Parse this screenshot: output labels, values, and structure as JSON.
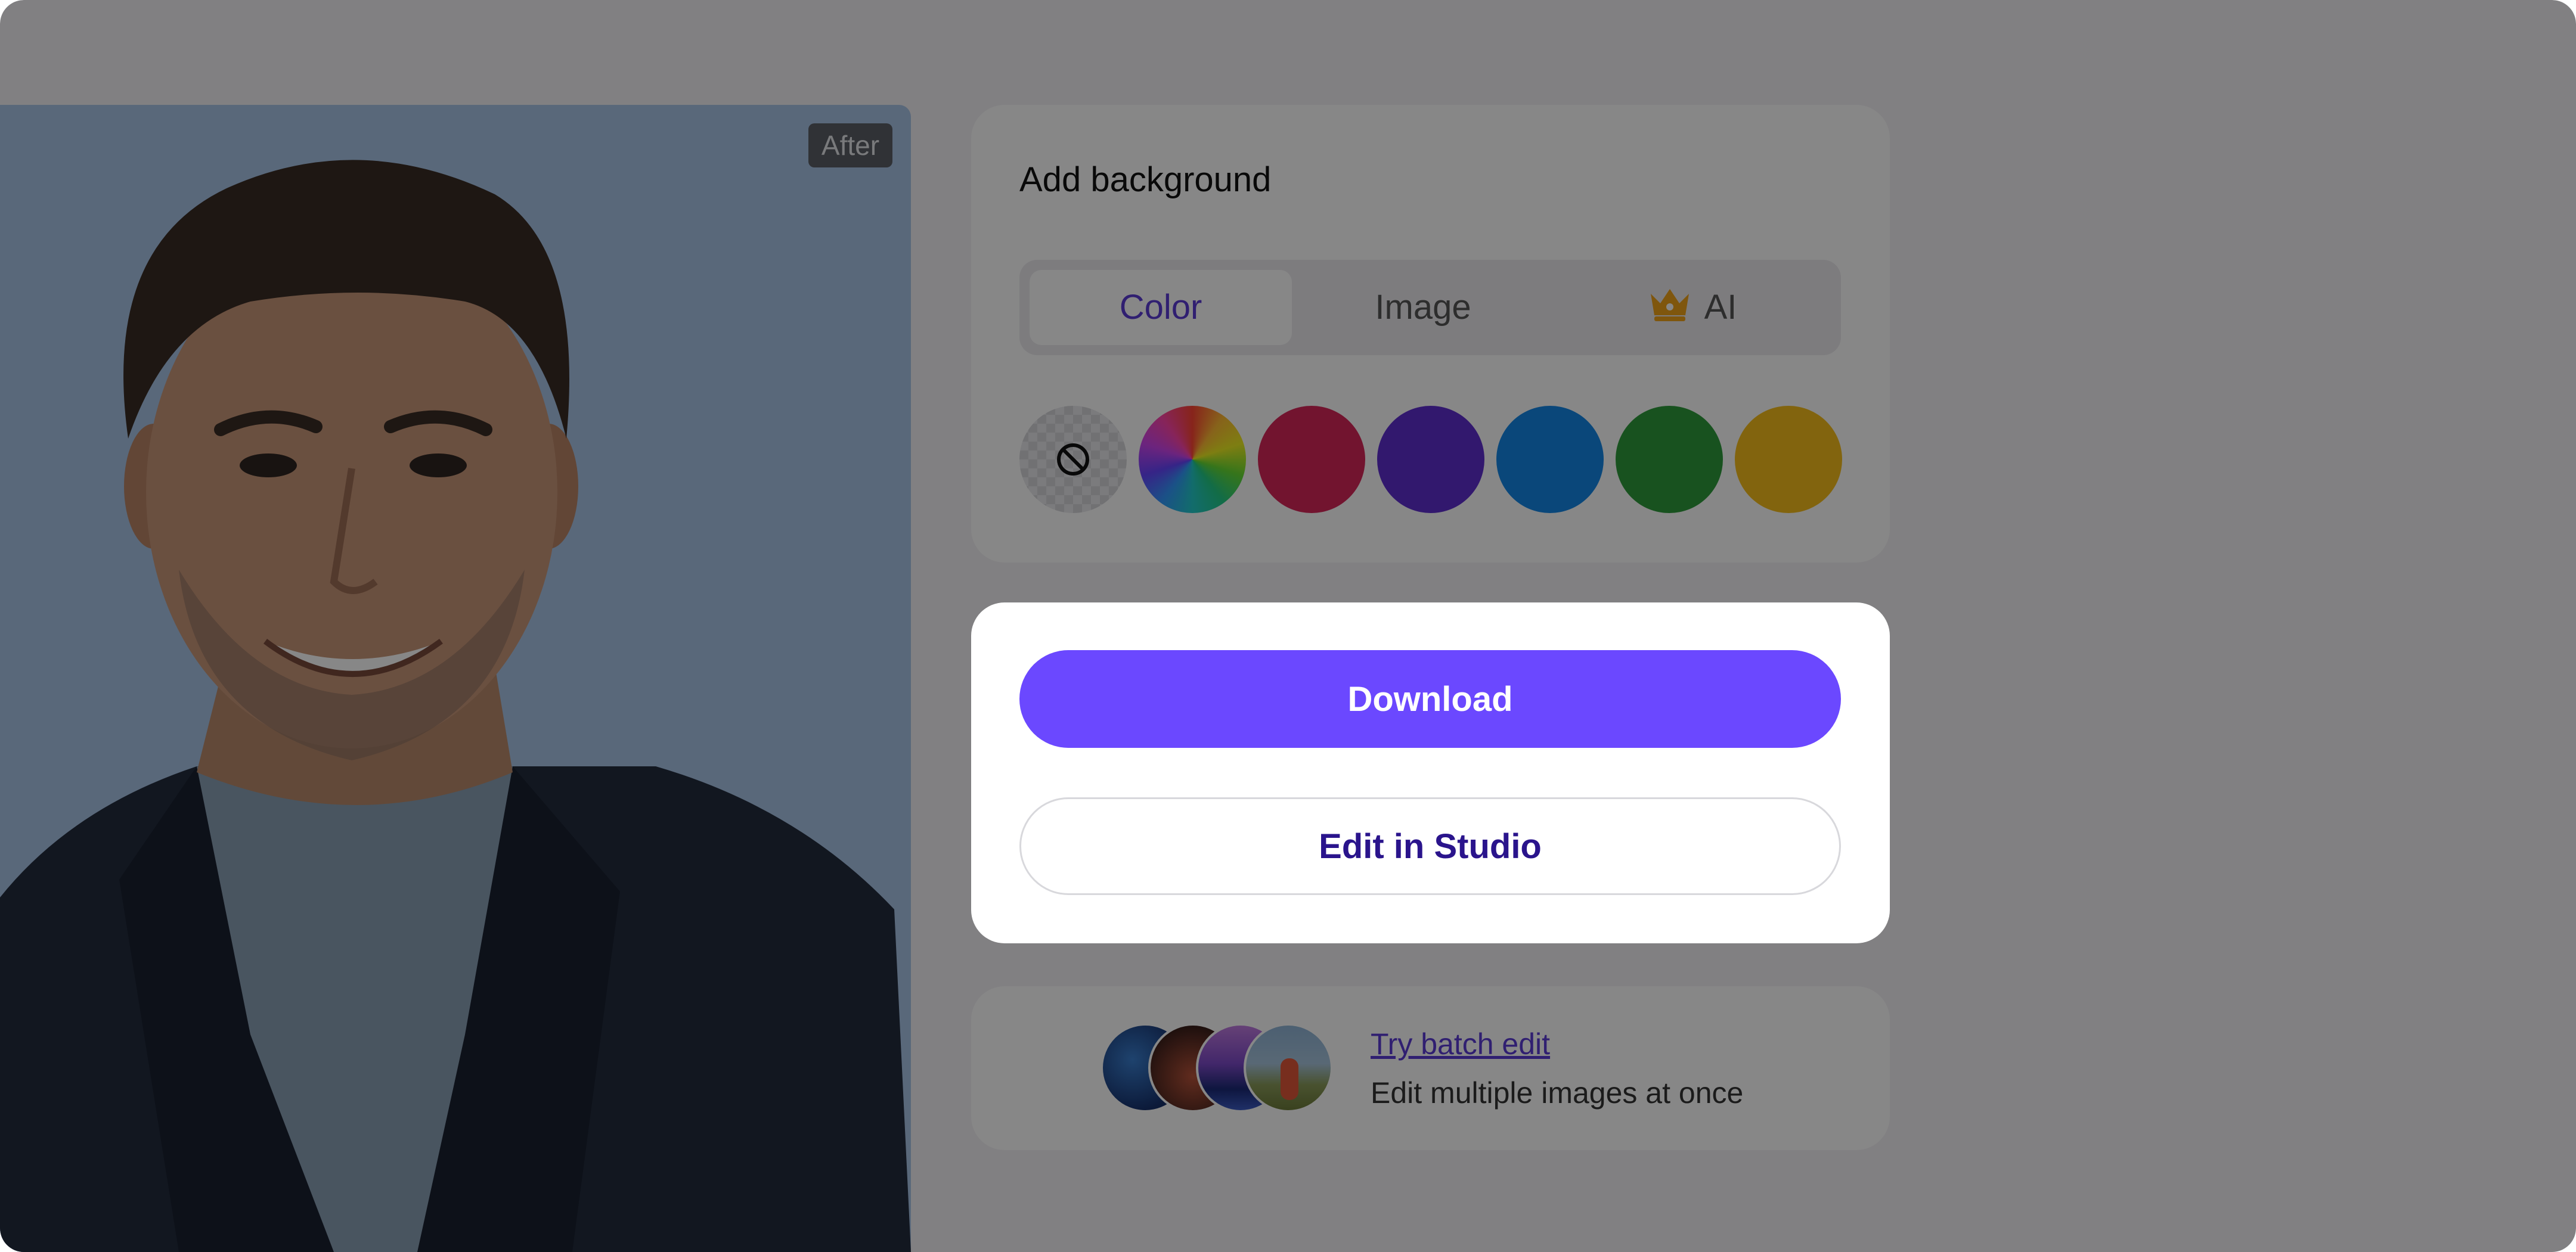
{
  "photo": {
    "badge_label": "After",
    "background_color": "#a9c4e6"
  },
  "background_panel": {
    "title": "Add background",
    "tabs": [
      {
        "label": "Color",
        "active": true
      },
      {
        "label": "Image",
        "active": false
      },
      {
        "label": "AI",
        "active": false,
        "icon": "crown-icon"
      }
    ],
    "swatches": [
      {
        "name": "none",
        "icon": "no-background-icon"
      },
      {
        "name": "rainbow",
        "color": "conic-rainbow"
      },
      {
        "name": "red",
        "color": "#d7265a"
      },
      {
        "name": "purple",
        "color": "#5f2fd0"
      },
      {
        "name": "blue",
        "color": "#1487e6"
      },
      {
        "name": "green",
        "color": "#2f9c3c"
      },
      {
        "name": "yellow",
        "color": "#f5be1c"
      }
    ]
  },
  "actions": {
    "download_label": "Download",
    "studio_label": "Edit in Studio"
  },
  "batch": {
    "link_label": "Try batch edit",
    "subtitle": "Edit multiple images at once"
  },
  "colors": {
    "accent": "#6b48ff",
    "studio_text": "#2a148c",
    "overlay": "rgba(0,0,0,0.47)"
  }
}
